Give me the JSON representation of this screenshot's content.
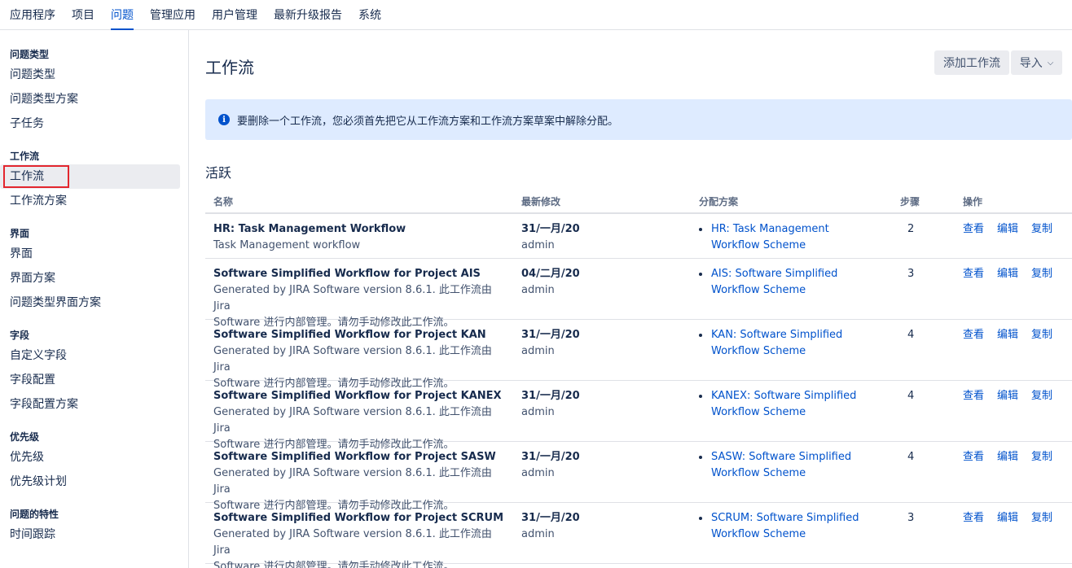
{
  "topnav": {
    "tabs": [
      {
        "label": "应用程序"
      },
      {
        "label": "项目"
      },
      {
        "label": "问题"
      },
      {
        "label": "管理应用"
      },
      {
        "label": "用户管理"
      },
      {
        "label": "最新升级报告"
      },
      {
        "label": "系统"
      }
    ],
    "active_index": 2
  },
  "sidebar": {
    "groups": [
      {
        "heading": "问题类型",
        "items": [
          "问题类型",
          "问题类型方案",
          "子任务"
        ]
      },
      {
        "heading": "工作流",
        "items": [
          "工作流",
          "工作流方案"
        ]
      },
      {
        "heading": "界面",
        "items": [
          "界面",
          "界面方案",
          "问题类型界面方案"
        ]
      },
      {
        "heading": "字段",
        "items": [
          "自定义字段",
          "字段配置",
          "字段配置方案"
        ]
      },
      {
        "heading": "优先级",
        "items": [
          "优先级",
          "优先级计划"
        ]
      },
      {
        "heading": "问题的特性",
        "items": [
          "时间跟踪"
        ]
      }
    ],
    "active_item": "工作流"
  },
  "main": {
    "title": "工作流",
    "add_button": "添加工作流",
    "import_button": "导入",
    "info_message": "要删除一个工作流，您必须首先把它从工作流方案和工作流方案草案中解除分配。",
    "section_title": "活跃",
    "columns": {
      "name": "名称",
      "modified": "最新修改",
      "schemes": "分配方案",
      "steps": "步骤",
      "actions": "操作"
    },
    "action_labels": {
      "view": "查看",
      "edit": "编辑",
      "copy": "复制"
    },
    "rows": [
      {
        "name": "HR: Task Management Workflow",
        "desc_1": "Task Management workflow",
        "desc_2": "",
        "date": "31/一月/20",
        "user": "admin",
        "scheme_1": "HR: Task Management",
        "scheme_2": "Workflow Scheme",
        "steps": "2"
      },
      {
        "name": "Software Simplified Workflow for Project AIS",
        "desc_1": "Generated by JIRA Software version 8.6.1. 此工作流由 Jira",
        "desc_2": "Software 进行内部管理。请勿手动修改此工作流。",
        "date": "04/二月/20",
        "user": "admin",
        "scheme_1": "AIS: Software Simplified",
        "scheme_2": "Workflow Scheme",
        "steps": "3"
      },
      {
        "name": "Software Simplified Workflow for Project KAN",
        "desc_1": "Generated by JIRA Software version 8.6.1. 此工作流由 Jira",
        "desc_2": "Software 进行内部管理。请勿手动修改此工作流。",
        "date": "31/一月/20",
        "user": "admin",
        "scheme_1": "KAN: Software Simplified",
        "scheme_2": "Workflow Scheme",
        "steps": "4"
      },
      {
        "name": "Software Simplified Workflow for Project KANEX",
        "desc_1": "Generated by JIRA Software version 8.6.1. 此工作流由 Jira",
        "desc_2": "Software 进行内部管理。请勿手动修改此工作流。",
        "date": "31/一月/20",
        "user": "admin",
        "scheme_1": "KANEX: Software Simplified",
        "scheme_2": "Workflow Scheme",
        "steps": "4"
      },
      {
        "name": "Software Simplified Workflow for Project SASW",
        "desc_1": "Generated by JIRA Software version 8.6.1. 此工作流由 Jira",
        "desc_2": "Software 进行内部管理。请勿手动修改此工作流。",
        "date": "31/一月/20",
        "user": "admin",
        "scheme_1": "SASW: Software Simplified",
        "scheme_2": "Workflow Scheme",
        "steps": "4"
      },
      {
        "name": "Software Simplified Workflow for Project SCRUM",
        "desc_1": "Generated by JIRA Software version 8.6.1. 此工作流由 Jira",
        "desc_2": "Software 进行内部管理。请勿手动修改此工作流。",
        "date": "31/一月/20",
        "user": "admin",
        "scheme_1": "SCRUM: Software Simplified",
        "scheme_2": "Workflow Scheme",
        "steps": "3"
      }
    ]
  }
}
